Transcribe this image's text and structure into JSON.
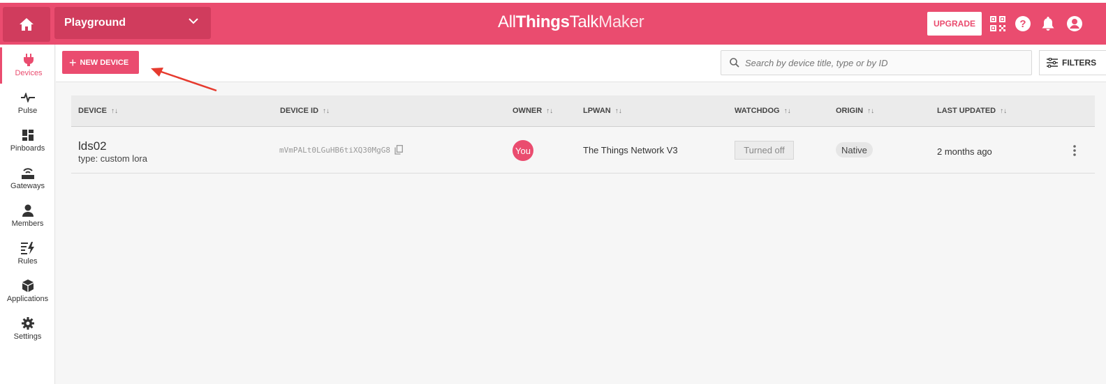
{
  "header": {
    "workspace": "Playground",
    "brand_all": "All",
    "brand_things": "Things",
    "brand_talk": "Talk",
    "brand_maker": "Maker",
    "upgrade_label": "UPGRADE",
    "accent_color": "#ea4c6f"
  },
  "sidebar": {
    "items": [
      {
        "label": "Devices",
        "icon": "plug-icon",
        "active": true
      },
      {
        "label": "Pulse",
        "icon": "pulse-icon"
      },
      {
        "label": "Pinboards",
        "icon": "dashboard-icon"
      },
      {
        "label": "Gateways",
        "icon": "router-icon"
      },
      {
        "label": "Members",
        "icon": "person-icon"
      },
      {
        "label": "Rules",
        "icon": "rules-icon"
      },
      {
        "label": "Applications",
        "icon": "cube-icon"
      },
      {
        "label": "Settings",
        "icon": "gear-icon"
      }
    ]
  },
  "toolbar": {
    "new_device_label": "NEW DEVICE",
    "search_placeholder": "Search by device title, type or by ID",
    "filters_label": "FILTERS"
  },
  "table": {
    "columns": [
      "DEVICE",
      "DEVICE ID",
      "OWNER",
      "LPWAN",
      "WATCHDOG",
      "ORIGIN",
      "LAST UPDATED"
    ],
    "rows": [
      {
        "title": "lds02",
        "type": "type: custom lora",
        "device_id": "mVmPALt0LGuHB6tiXQ30MgG8",
        "owner": "You",
        "lpwan": "The Things Network V3",
        "watchdog": "Turned off",
        "origin": "Native",
        "last_updated": "2 months ago"
      }
    ]
  }
}
